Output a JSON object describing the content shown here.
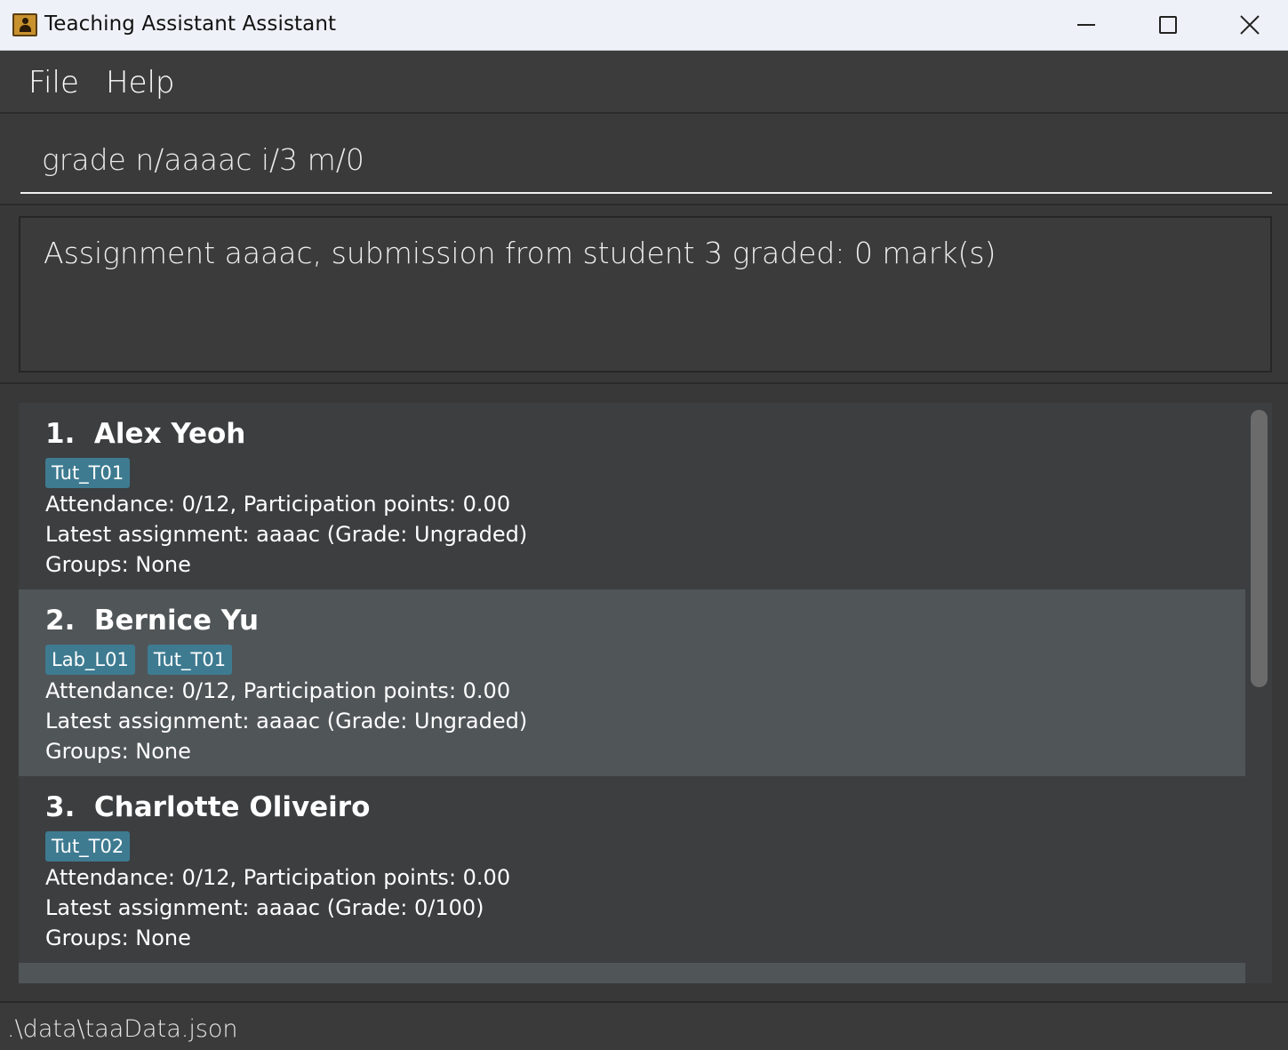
{
  "window": {
    "title": "Teaching Assistant Assistant"
  },
  "menu": {
    "file": "File",
    "help": "Help"
  },
  "command": {
    "value": "grade n/aaaac i/3 m/0"
  },
  "result": {
    "text": "Assignment aaaac, submission from student 3 graded: 0 mark(s)"
  },
  "students": [
    {
      "name": "1.  Alex Yeoh",
      "tags": [
        "Tut_T01"
      ],
      "attendance": "Attendance: 0/12, Participation points: 0.00",
      "assignment": "Latest assignment: aaaac (Grade: Ungraded)",
      "groups": "Groups: None"
    },
    {
      "name": "2.  Bernice Yu",
      "tags": [
        "Lab_L01",
        "Tut_T01"
      ],
      "attendance": "Attendance: 0/12, Participation points: 0.00",
      "assignment": "Latest assignment: aaaac (Grade: Ungraded)",
      "groups": "Groups: None"
    },
    {
      "name": "3.  Charlotte Oliveiro",
      "tags": [
        "Tut_T02"
      ],
      "attendance": "Attendance: 0/12, Participation points: 0.00",
      "assignment": "Latest assignment: aaaac (Grade: 0/100)",
      "groups": "Groups: None"
    }
  ],
  "status": {
    "file_path": ".\\data\\taaData.json"
  },
  "colors": {
    "tag": "#3e7b91",
    "card_odd": "#3c3e40",
    "card_even": "#505558"
  }
}
